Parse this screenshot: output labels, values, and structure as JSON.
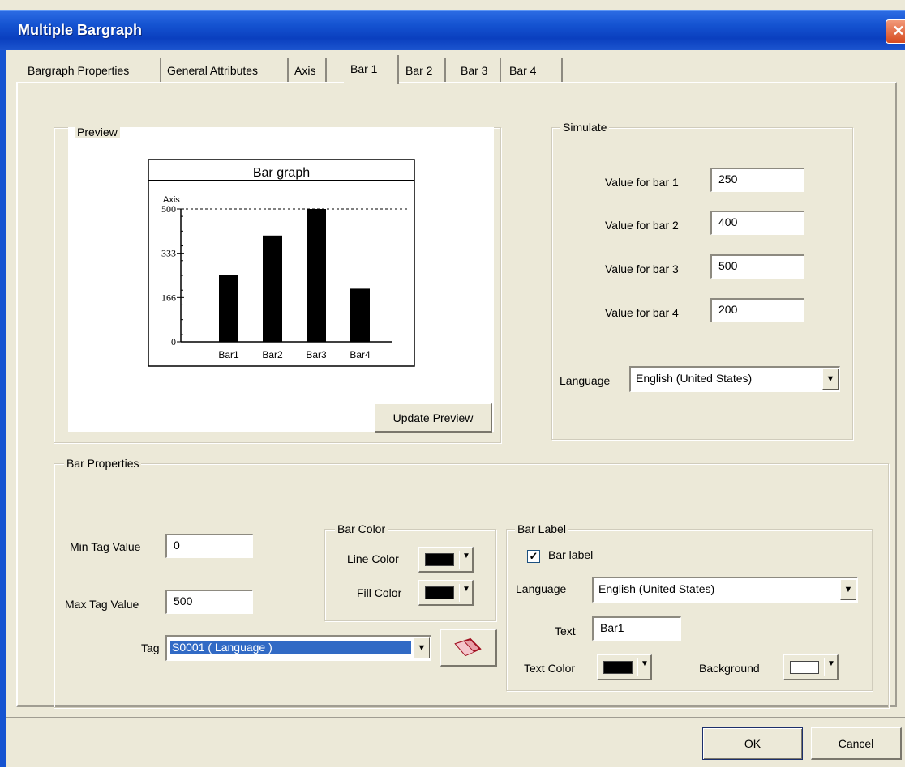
{
  "window": {
    "title": "Multiple Bargraph",
    "close_glyph": "✕"
  },
  "tabs": [
    {
      "label": "Bargraph Properties"
    },
    {
      "label": "General Attributes"
    },
    {
      "label": "Axis"
    },
    {
      "label": "Bar 1",
      "active": true
    },
    {
      "label": "Bar 2"
    },
    {
      "label": "Bar 3"
    },
    {
      "label": "Bar 4"
    }
  ],
  "preview": {
    "group_label": "Preview",
    "update_button": "Update Preview"
  },
  "chart_data": {
    "type": "bar",
    "title": "Bar graph",
    "ylabel": "Axis",
    "categories": [
      "Bar1",
      "Bar2",
      "Bar3",
      "Bar4"
    ],
    "values": [
      250,
      400,
      500,
      200
    ],
    "yticks": [
      "0",
      "166",
      "333",
      "500"
    ],
    "ylim": [
      0,
      500
    ],
    "bar_color": "#000000",
    "reference_line": 500
  },
  "simulate": {
    "group_label": "Simulate",
    "rows": [
      {
        "label": "Value for bar 1",
        "value": "250"
      },
      {
        "label": "Value for bar 2",
        "value": "400"
      },
      {
        "label": "Value for bar 3",
        "value": "500"
      },
      {
        "label": "Value for bar 4",
        "value": "200"
      }
    ],
    "language_label": "Language",
    "language_value": "English (United States)"
  },
  "bar_properties": {
    "group_label": "Bar Properties",
    "min_label": "Min Tag Value",
    "min_value": "0",
    "max_label": "Max Tag Value",
    "max_value": "500",
    "tag_label": "Tag",
    "tag_value": "S0001 ( Language )",
    "tag_button_icon": "eraser-icon"
  },
  "bar_color": {
    "group_label": "Bar Color",
    "line_label": "Line Color",
    "line_color": "#000000",
    "fill_label": "Fill Color",
    "fill_color": "#000000"
  },
  "bar_label": {
    "group_label": "Bar Label",
    "checkbox_label": "Bar label",
    "checked": true,
    "check_glyph": "✓",
    "language_label": "Language",
    "language_value": "English (United States)",
    "text_label": "Text",
    "text_value": "Bar1",
    "text_color_label": "Text Color",
    "text_color": "#000000",
    "background_label": "Background",
    "background_color": "#ffffff"
  },
  "dropdown_glyph": "▼",
  "footer": {
    "ok_label": "OK",
    "cancel_label": "Cancel"
  }
}
